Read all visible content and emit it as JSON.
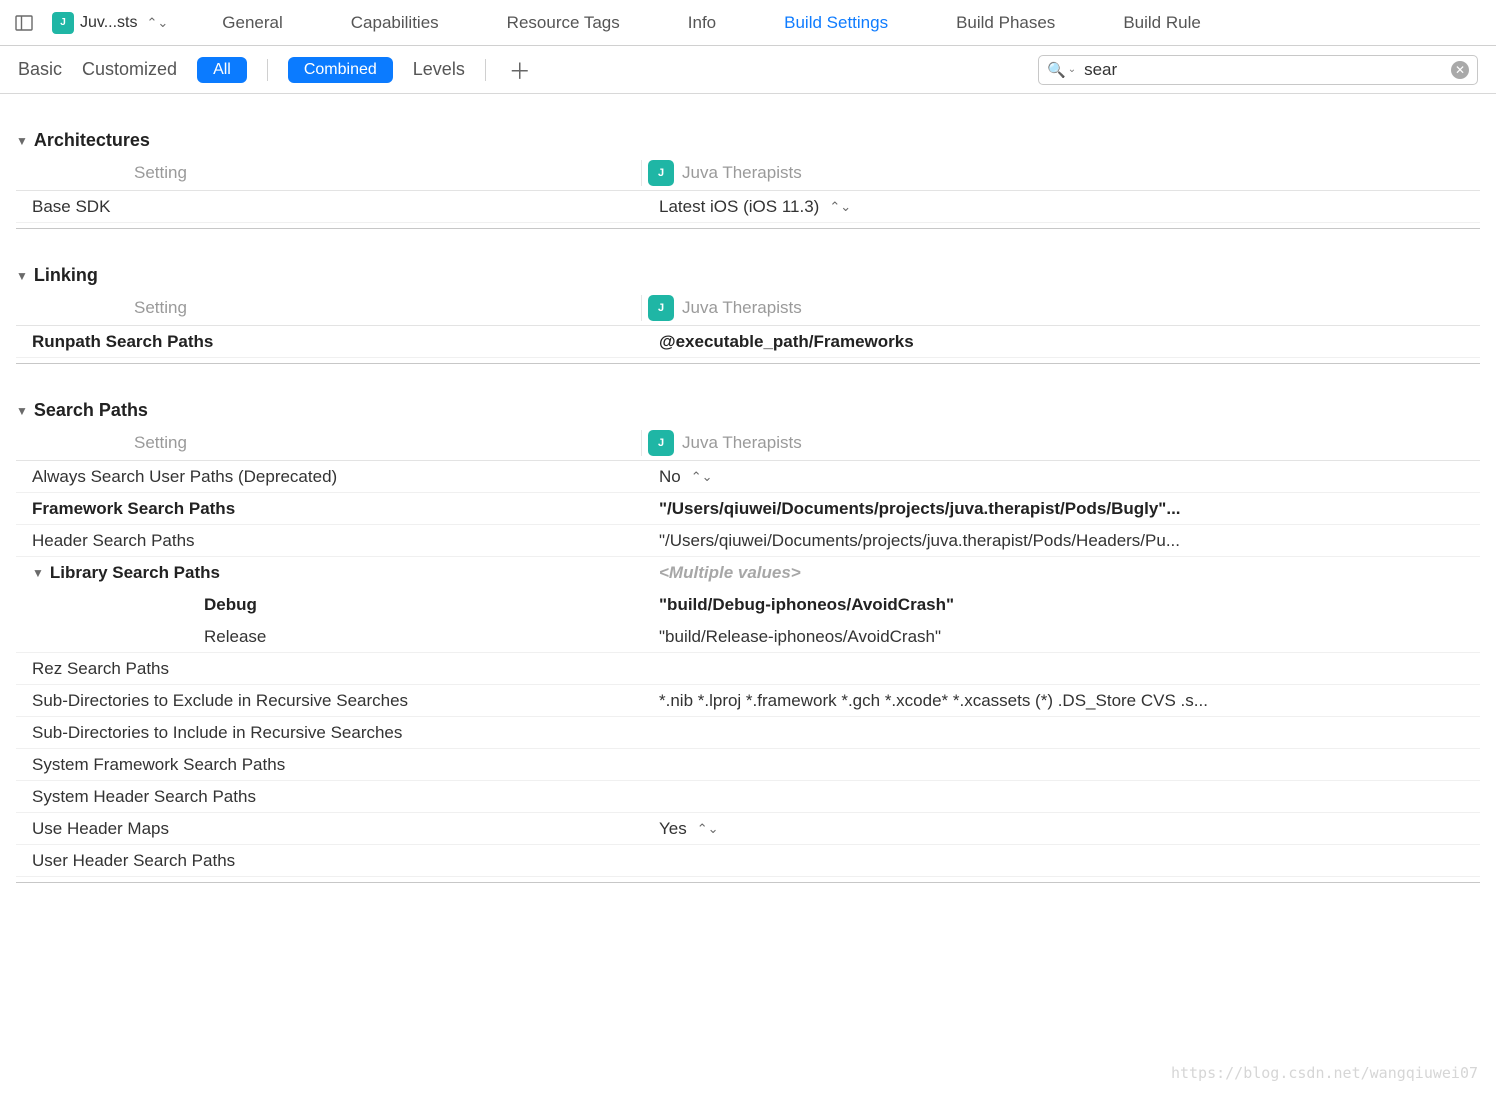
{
  "target": {
    "icon_label": "J",
    "name_truncated": "Juv...sts",
    "full_name": "Juva Therapists"
  },
  "tabs": {
    "general": "General",
    "capabilities": "Capabilities",
    "resource_tags": "Resource Tags",
    "info": "Info",
    "build_settings": "Build Settings",
    "build_phases": "Build Phases",
    "build_rules": "Build Rule"
  },
  "filters": {
    "basic": "Basic",
    "customized": "Customized",
    "all": "All",
    "combined": "Combined",
    "levels": "Levels"
  },
  "search": {
    "value": "sear"
  },
  "columns": {
    "setting": "Setting"
  },
  "sections": {
    "architectures": {
      "title": "Architectures",
      "rows": {
        "base_sdk": {
          "label": "Base SDK",
          "value": "Latest iOS (iOS 11.3)"
        }
      }
    },
    "linking": {
      "title": "Linking",
      "rows": {
        "runpath": {
          "label": "Runpath Search Paths",
          "value": "@executable_path/Frameworks"
        }
      }
    },
    "search_paths": {
      "title": "Search Paths",
      "rows": {
        "always_search": {
          "label": "Always Search User Paths (Deprecated)",
          "value": "No"
        },
        "framework": {
          "label": "Framework Search Paths",
          "value": "\"/Users/qiuwei/Documents/projects/juva.therapist/Pods/Bugly\"..."
        },
        "header": {
          "label": "Header Search Paths",
          "value": "\"/Users/qiuwei/Documents/projects/juva.therapist/Pods/Headers/Pu..."
        },
        "library": {
          "label": "Library Search Paths",
          "value": "<Multiple values>",
          "debug_label": "Debug",
          "debug_value": "\"build/Debug-iphoneos/AvoidCrash\"",
          "release_label": "Release",
          "release_value": "\"build/Release-iphoneos/AvoidCrash\""
        },
        "rez": {
          "label": "Rez Search Paths",
          "value": ""
        },
        "exclude": {
          "label": "Sub-Directories to Exclude in Recursive Searches",
          "value": "*.nib *.lproj *.framework *.gch *.xcode* *.xcassets (*) .DS_Store CVS .s..."
        },
        "include": {
          "label": "Sub-Directories to Include in Recursive Searches",
          "value": ""
        },
        "sys_fw": {
          "label": "System Framework Search Paths",
          "value": ""
        },
        "sys_header": {
          "label": "System Header Search Paths",
          "value": ""
        },
        "use_header_maps": {
          "label": "Use Header Maps",
          "value": "Yes"
        },
        "user_header": {
          "label": "User Header Search Paths",
          "value": ""
        }
      }
    }
  },
  "watermark": "https://blog.csdn.net/wangqiuwei07"
}
